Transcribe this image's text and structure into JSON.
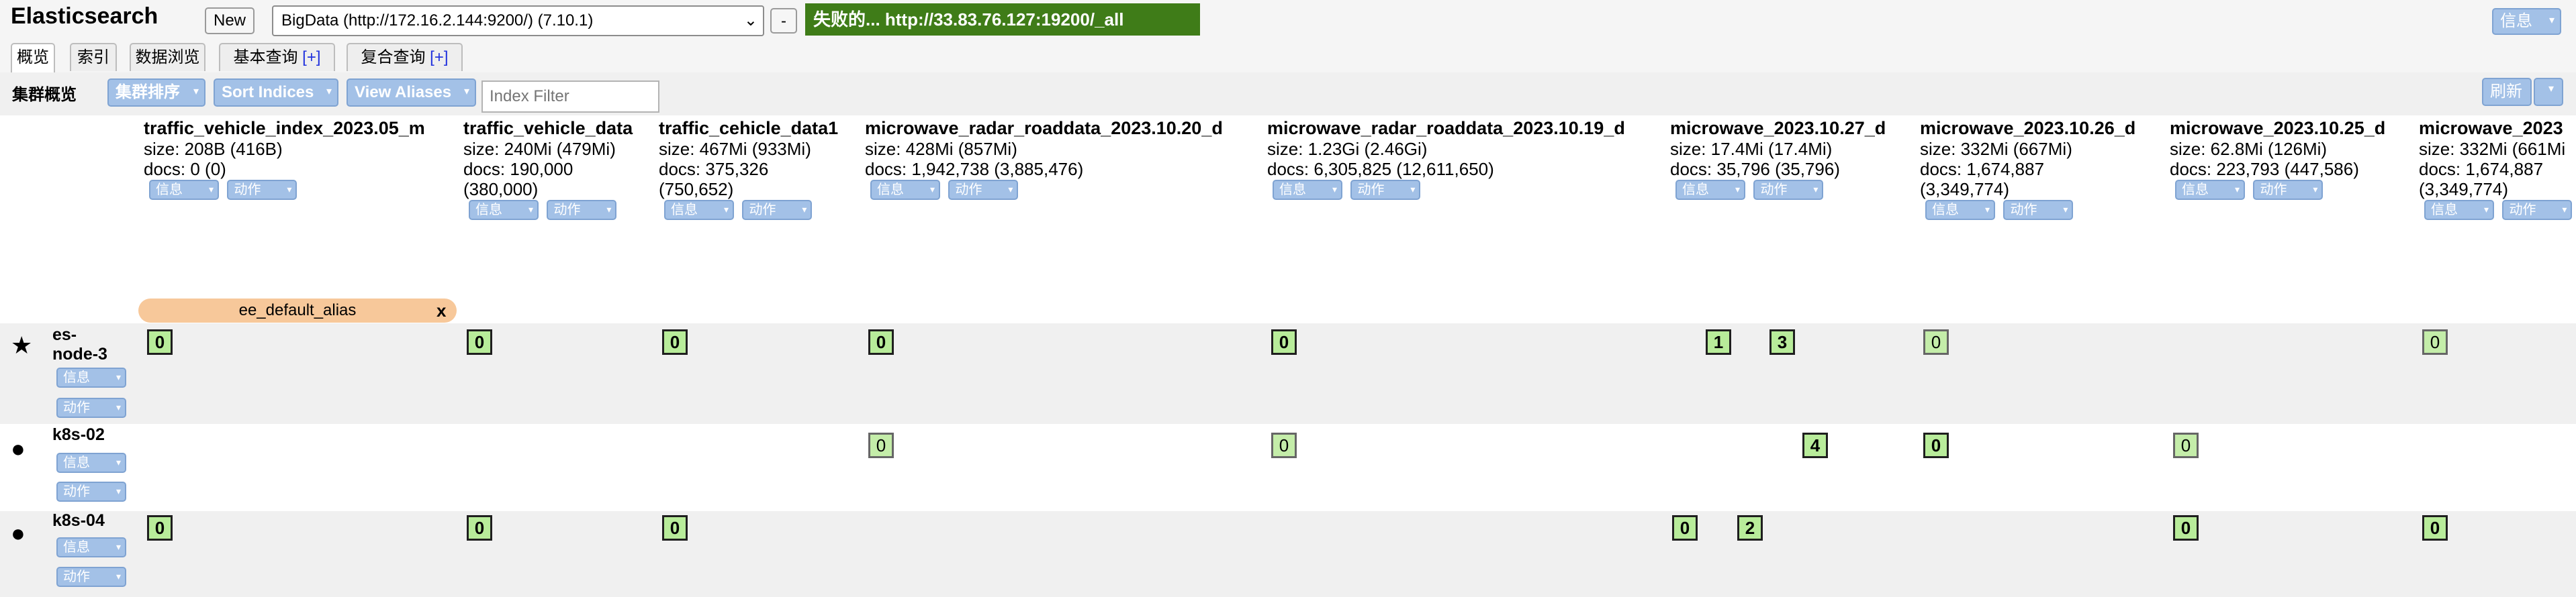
{
  "header": {
    "title": "Elasticsearch",
    "new_label": "New",
    "cluster_url": "BigData (http://172.16.2.144:9200/) (7.10.1)",
    "minus_label": "-",
    "status_text": "失败的... http://33.83.76.127:19200/_all",
    "info_label": "信息"
  },
  "tabs": [
    {
      "label": "概览"
    },
    {
      "label": "索引"
    },
    {
      "label": "数据浏览"
    },
    {
      "label": "基本查询",
      "plus": "[+]"
    },
    {
      "label": "复合查询",
      "plus": "[+]"
    }
  ],
  "toolbar": {
    "title": "集群概览",
    "sort_cluster": "集群排序",
    "sort_indices": "Sort Indices",
    "view_aliases": "View Aliases",
    "filter_placeholder": "Index Filter",
    "refresh": "刷新"
  },
  "buttons": {
    "info": "信息",
    "action": "动作"
  },
  "indices": [
    {
      "name": "traffic_vehicle_index_2023.05_m",
      "size": "size: 208B (416B)",
      "docs": "docs: 0 (0)",
      "docs2": ""
    },
    {
      "name": "traffic_vehicle_data",
      "size": "size: 240Mi (479Mi)",
      "docs": "docs: 190,000",
      "docs2": "(380,000)"
    },
    {
      "name": "traffic_cehicle_data1",
      "size": "size: 467Mi (933Mi)",
      "docs": "docs: 375,326",
      "docs2": "(750,652)"
    },
    {
      "name": "microwave_radar_roaddata_2023.10.20_d",
      "size": "size: 428Mi (857Mi)",
      "docs": "docs: 1,942,738 (3,885,476)",
      "docs2": ""
    },
    {
      "name": "microwave_radar_roaddata_2023.10.19_d",
      "size": "size: 1.23Gi (2.46Gi)",
      "docs": "docs: 6,305,825 (12,611,650)",
      "docs2": ""
    },
    {
      "name": "microwave_2023.10.27_d",
      "size": "size: 17.4Mi (17.4Mi)",
      "docs": "docs: 35,796 (35,796)",
      "docs2": ""
    },
    {
      "name": "microwave_2023.10.26_d",
      "size": "size: 332Mi (667Mi)",
      "docs": "docs: 1,674,887",
      "docs2": "(3,349,774)"
    },
    {
      "name": "microwave_2023.10.25_d",
      "size": "size: 62.8Mi (126Mi)",
      "docs": "docs: 223,793 (447,586)",
      "docs2": ""
    },
    {
      "name": "microwave_2023",
      "size": "size: 332Mi (661Mi",
      "docs": "docs: 1,674,887",
      "docs2": "(3,349,774)"
    }
  ],
  "alias": {
    "label": "ee_default_alias",
    "close": "x"
  },
  "nodes": [
    {
      "name_line1": "es-",
      "name_line2": "node-3",
      "icon": "star-icon",
      "icon_glyph": "★"
    },
    {
      "name_line1": "k8s-02",
      "name_line2": "",
      "icon": "circle-icon",
      "icon_glyph": "●"
    },
    {
      "name_line1": "k8s-04",
      "name_line2": "",
      "icon": "circle-icon",
      "icon_glyph": "●"
    }
  ],
  "shards": {
    "node0": [
      "0",
      "0",
      "0",
      "0",
      "0",
      "1",
      "3",
      "0",
      "0"
    ],
    "node1": [
      "0",
      "0",
      "4",
      "0",
      "0"
    ],
    "node2": [
      "0",
      "0",
      "0",
      "0",
      "2",
      "0",
      "0"
    ]
  },
  "colors": {
    "status_bg": "#3f7c18",
    "button_blue": "#a3c1e7",
    "alias_bg": "#f7c89a",
    "shard_green": "#b8ec9a",
    "row_stripe": "#f0f0f0"
  }
}
